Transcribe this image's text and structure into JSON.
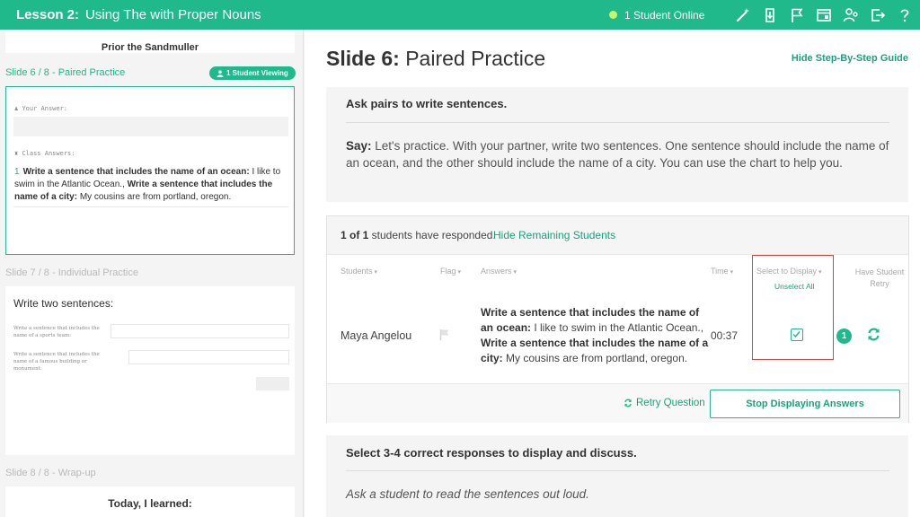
{
  "header": {
    "lesson_label": "Lesson 2:",
    "lesson_title": "Using The with Proper Nouns",
    "online_status": "1 Student Online",
    "icons": [
      "magic-wand-icon",
      "download-icon",
      "flag-icon",
      "window-icon",
      "users-gear-icon",
      "exit-icon",
      "help-icon"
    ],
    "accent_color": "#1fb98b"
  },
  "sidebar": {
    "prev_card_text": "Prior the Sandmuller",
    "slide6": {
      "label": "Slide 6 / 8 - Paired Practice",
      "viewing_badge": "1 Student Viewing",
      "your_answer_label": "Your Answer:",
      "class_answers_label": "Class Answers:",
      "answer_number": "1",
      "answer_q1": "Write a sentence that includes the name of an ocean:",
      "answer_a1": "I like to swim in the Atlantic Ocean.,",
      "answer_q2": "Write a sentence that includes the name of a city:",
      "answer_a2": "My cousins are from portland, oregon."
    },
    "slide7": {
      "label": "Slide 7 / 8 - Individual Practice",
      "heading": "Write two sentences:",
      "q1": "Write a sentence that includes the name of a sports team:",
      "q2": "Write a sentence that includes the name of a famous building or monument:"
    },
    "slide8": {
      "label": "Slide 8 / 8 - Wrap-up",
      "heading": "Today, I learned:"
    }
  },
  "main": {
    "slide_number": "Slide 6:",
    "slide_name": "Paired Practice",
    "hide_guide": "Hide Step-By-Step Guide",
    "step1": {
      "heading": "Ask pairs to write sentences.",
      "say_label": "Say:",
      "say_text": " Let's practice. With your partner, write two sentences. One sentence should include the name of an ocean, and the other should include the name of a city. You can use the chart to help you."
    },
    "responses": {
      "count_bold": "1 of 1",
      "count_text": " students have responded.",
      "hide_remaining": "Hide Remaining Students",
      "columns": {
        "students": "Students",
        "flag": "Flag",
        "answers": "Answers",
        "time": "Time",
        "select_display": "Select to Display",
        "have_retry": "Have Student Retry"
      },
      "unselect_all": "Unselect All",
      "row": {
        "student": "Maya Angelou",
        "q1": "Write a sentence that includes the name of an ocean:",
        "a1": " I like to swim in the Atlantic Ocean.,",
        "q2": "Write a sentence that includes the name of a city:",
        "a2": " My cousins are from portland, oregon.",
        "time": "00:37",
        "selected": true,
        "display_number": "1"
      },
      "retry_question": "Retry Question",
      "stop_displaying": "Stop Displaying Answers"
    },
    "step2": {
      "heading": "Select 3-4 correct responses to display and discuss.",
      "instruction": "Ask a student to read the sentences out loud."
    }
  }
}
